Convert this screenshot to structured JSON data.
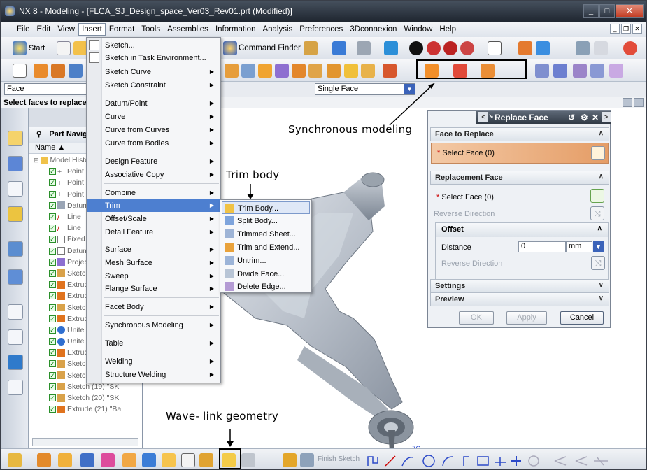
{
  "window": {
    "title": "NX 8 - Modeling - [FLCA_SJ_Design_space_Ver03_Rev01.prt (Modified)]",
    "min": "_",
    "max": "□",
    "close": "✕"
  },
  "menubar": {
    "items": [
      "File",
      "Edit",
      "View",
      "Insert",
      "Format",
      "Tools",
      "Assemblies",
      "Information",
      "Analysis",
      "Preferences",
      "3Dconnexion",
      "Window",
      "Help"
    ],
    "active": "Insert"
  },
  "toolbar": {
    "start_label": "Start",
    "command_finder": "Command Finder"
  },
  "filter": {
    "type_value": "Face",
    "scope_value": "Single Face"
  },
  "cue_line": "Select faces to replace",
  "navigator": {
    "title": "Part Navigator",
    "column_name": "Name",
    "root": "Model History",
    "rows": [
      "Point",
      "Point",
      "Point",
      "Datum",
      "Line",
      "Line",
      "Fixed",
      "Datum",
      "Project",
      "Sketch",
      "Extrude",
      "Extrude",
      "Sketch",
      "Extrude",
      "Unite",
      "Unite",
      "Extrude",
      "Sketch",
      "Sketch (18) \"SK",
      "Sketch (19) \"SK",
      "Sketch (20) \"SK",
      "Extrude (21) \"Ba"
    ]
  },
  "insert_menu": {
    "items": [
      {
        "label": "Sketch...",
        "sub": false
      },
      {
        "label": "Sketch in Task Environment...",
        "sub": false
      },
      {
        "label": "Sketch Curve",
        "sub": true
      },
      {
        "label": "Sketch Constraint",
        "sub": true
      },
      {
        "label": "Datum/Point",
        "sub": true
      },
      {
        "label": "Curve",
        "sub": true
      },
      {
        "label": "Curve from Curves",
        "sub": true
      },
      {
        "label": "Curve from Bodies",
        "sub": true
      },
      {
        "label": "Design Feature",
        "sub": true
      },
      {
        "label": "Associative Copy",
        "sub": true
      },
      {
        "label": "Combine",
        "sub": true
      },
      {
        "label": "Trim",
        "sub": true
      },
      {
        "label": "Offset/Scale",
        "sub": true
      },
      {
        "label": "Detail Feature",
        "sub": true
      },
      {
        "label": "Surface",
        "sub": true
      },
      {
        "label": "Mesh Surface",
        "sub": true
      },
      {
        "label": "Sweep",
        "sub": true
      },
      {
        "label": "Flange Surface",
        "sub": true
      },
      {
        "label": "Facet Body",
        "sub": true
      },
      {
        "label": "Synchronous Modeling",
        "sub": true
      },
      {
        "label": "Table",
        "sub": true
      },
      {
        "label": "Welding",
        "sub": true
      },
      {
        "label": "Structure Welding",
        "sub": true
      }
    ],
    "highlighted": "Trim"
  },
  "trim_menu": {
    "items": [
      "Trim Body...",
      "Split Body...",
      "Trimmed Sheet...",
      "Trim and Extend...",
      "Untrim...",
      "Divide Face...",
      "Delete Edge..."
    ],
    "highlighted": "Trim Body..."
  },
  "dialog": {
    "title": "Replace Face",
    "sec_face_to_replace": "Face to Replace",
    "select_face_1": "Select Face (0)",
    "sec_replacement": "Replacement Face",
    "select_face_2": "Select Face (0)",
    "reverse_direction": "Reverse Direction",
    "sec_offset": "Offset",
    "distance_label": "Distance",
    "distance_value": "0",
    "distance_unit": "mm",
    "reverse_direction_2": "Reverse Direction",
    "sec_settings": "Settings",
    "sec_preview": "Preview",
    "ok": "OK",
    "apply": "Apply",
    "cancel": "Cancel"
  },
  "bottom": {
    "finish_sketch": "Finish Sketch",
    "zc": "ZC"
  },
  "annotations": {
    "sync": "Synchronous modeling",
    "trim": "Trim body",
    "wave": "Wave- link geometry"
  }
}
